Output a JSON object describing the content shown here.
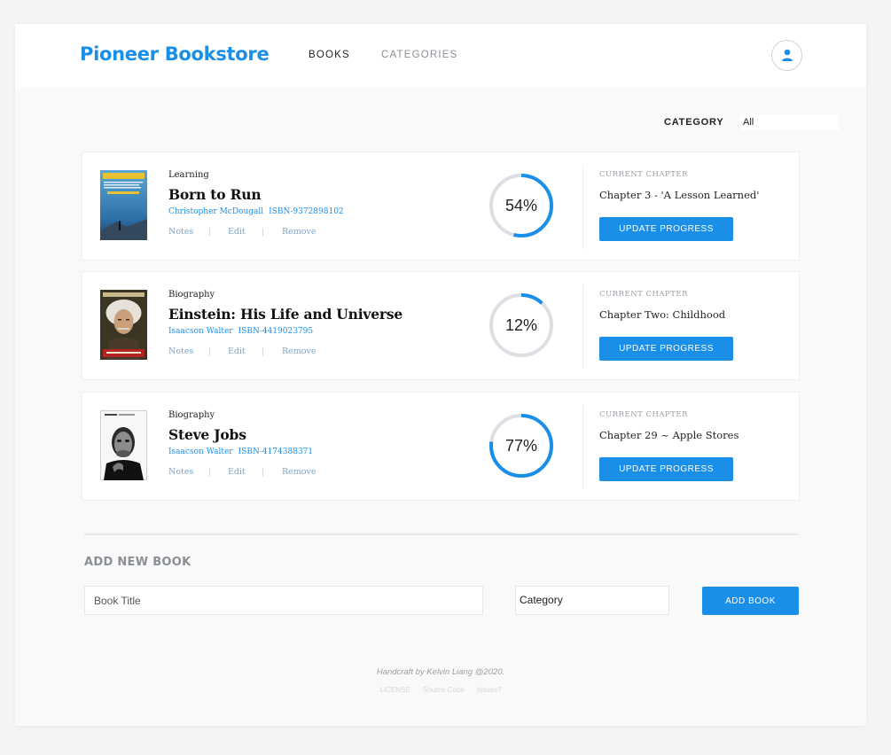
{
  "header": {
    "brand": "Pioneer Bookstore",
    "nav": [
      {
        "label": "BOOKS",
        "active": true
      },
      {
        "label": "CATEGORIES",
        "active": false
      }
    ],
    "user_icon": "user-icon"
  },
  "filter": {
    "label": "CATEGORY",
    "value": "All"
  },
  "accent_color": "#1a8fe8",
  "books": [
    {
      "category": "Learning",
      "title": "Born to Run",
      "author": "Christopher McDougall",
      "isbn": "ISBN-9372898102",
      "actions": [
        "Notes",
        "Edit",
        "Remove"
      ],
      "progress": 54,
      "progress_label": "54%",
      "chapter_label": "CURRENT CHAPTER",
      "chapter": "Chapter 3 - 'A Lesson Learned'",
      "button": "UPDATE PROGRESS"
    },
    {
      "category": "Biography",
      "title": "Einstein: His Life and Universe",
      "author": "Isaacson Walter",
      "isbn": "ISBN-4419023795",
      "actions": [
        "Notes",
        "Edit",
        "Remove"
      ],
      "progress": 12,
      "progress_label": "12%",
      "chapter_label": "CURRENT CHAPTER",
      "chapter": "Chapter Two: Childhood",
      "button": "UPDATE PROGRESS"
    },
    {
      "category": "Biography",
      "title": "Steve Jobs",
      "author": "Isaacson Walter",
      "isbn": "ISBN-4174388371",
      "actions": [
        "Notes",
        "Edit",
        "Remove"
      ],
      "progress": 77,
      "progress_label": "77%",
      "chapter_label": "CURRENT CHAPTER",
      "chapter": "Chapter 29 ~ Apple Stores",
      "button": "UPDATE PROGRESS"
    }
  ],
  "add_book": {
    "heading": "ADD NEW BOOK",
    "title_placeholder": "Book Title",
    "category_value": "Category",
    "button": "ADD BOOK"
  },
  "footer": {
    "credit": "Handcraft by Kelvin Liang @2020.",
    "links": [
      "LICENSE",
      "Source Code",
      "Issues?"
    ]
  }
}
